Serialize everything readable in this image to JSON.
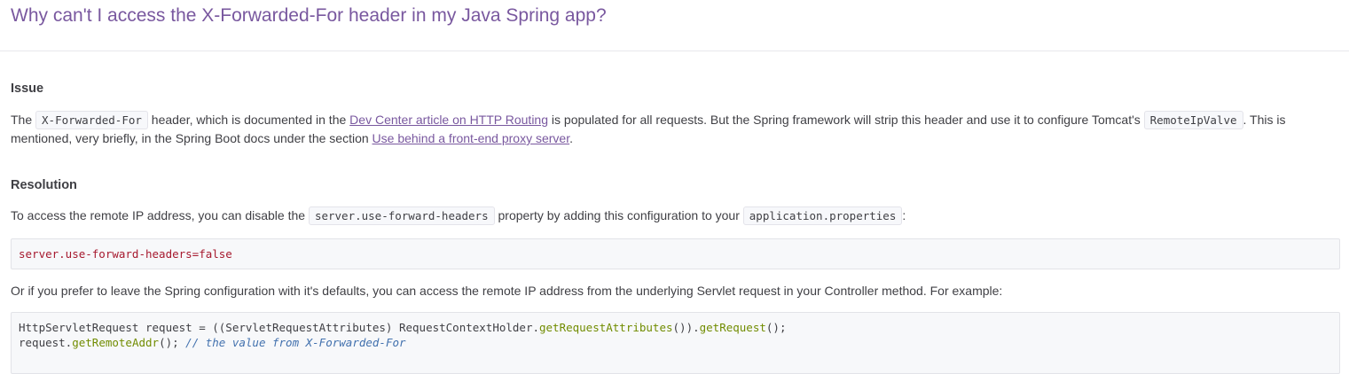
{
  "title": "Why can't I access the X-Forwarded-For header in my Java Spring app?",
  "issue": {
    "heading": "Issue",
    "t1": "The ",
    "code1": "X-Forwarded-For",
    "t2": " header, which is documented in the ",
    "link1": "Dev Center article on HTTP Routing",
    "t3": " is populated for all requests. But the Spring framework will strip this header and use it to configure Tomcat's ",
    "code2": "RemoteIpValve",
    "t4": ". This is mentioned, very briefly, in the Spring Boot docs under the section ",
    "link2": "Use behind a front-end proxy server",
    "t5": "."
  },
  "resolution": {
    "heading": "Resolution",
    "t1": "To access the remote IP address, you can disable the ",
    "code1": "server.use-forward-headers",
    "t2": " property by adding this configuration to your ",
    "code2": "application.properties",
    "t3": ":",
    "config_code": "server.use-forward-headers=false",
    "para2": "Or if you prefer to leave the Spring configuration with it's defaults, you can access the remote IP address from the underlying Servlet request in your Controller method. For example:",
    "java": {
      "l1a": "HttpServletRequest request = ((ServletRequestAttributes) RequestContextHolder.",
      "l1b": "getRequestAttributes",
      "l1c": "()).",
      "l1d": "getRequest",
      "l1e": "();",
      "l2a": "request.",
      "l2b": "getRemoteAddr",
      "l2c": "(); ",
      "l2d": "// the value from X-Forwarded-For"
    }
  }
}
